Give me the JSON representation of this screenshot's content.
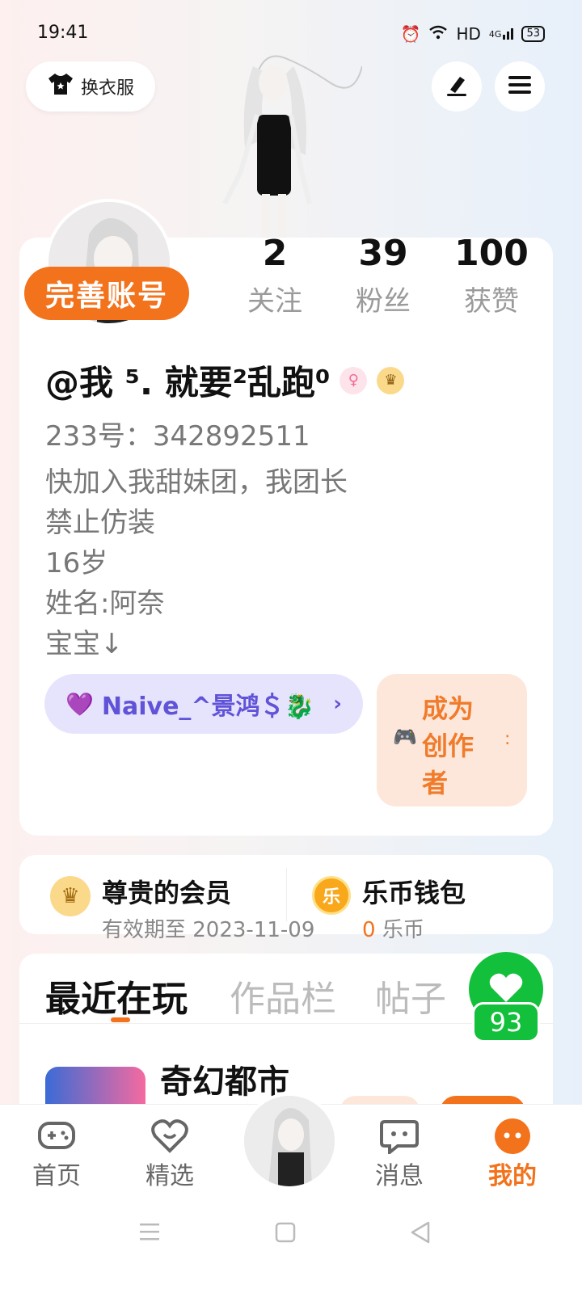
{
  "status_bar": {
    "time": "19:41",
    "network": "HD",
    "signal": "4G",
    "battery": "53"
  },
  "header": {
    "outfit_label": "换衣服"
  },
  "profile": {
    "complete_label": "完善账号",
    "stats": [
      {
        "num": "2",
        "label": "关注"
      },
      {
        "num": "39",
        "label": "粉丝"
      },
      {
        "num": "100",
        "label": "获赞"
      }
    ],
    "username": "@我 ⁵. 就要²乱跑⁰",
    "uid": "233号：342892511",
    "bio": [
      "快加入我甜妹团，我团长",
      "禁止仿装",
      "16岁",
      "姓名:阿奈",
      "宝宝↓"
    ],
    "cp_name": "Naive_^景鸿＄🐉",
    "creator_lines": [
      "成为",
      "创作",
      "者"
    ]
  },
  "membership": {
    "title": "尊贵的会员",
    "expiry": "有效期至 2023-11-09",
    "wallet_title": "乐币钱包",
    "coin_amount": "0",
    "coin_unit": "乐币",
    "coin_icon": "乐"
  },
  "tabs": [
    "最近在玩",
    "作品栏",
    "帖子"
  ],
  "likes": {
    "count": "93"
  },
  "recent": {
    "game_title": "奇幻都市"
  },
  "bottom_nav": [
    {
      "label": "首页"
    },
    {
      "label": "精选"
    },
    {
      "label": "消息"
    },
    {
      "label": "我的"
    }
  ],
  "colors": {
    "accent": "#f3721c",
    "cp": "#6153d8",
    "like": "#13c03b"
  }
}
